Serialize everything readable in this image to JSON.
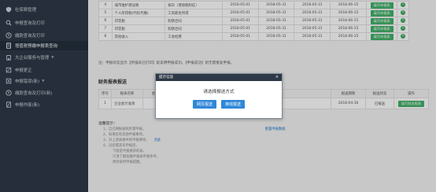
{
  "sidebar": {
    "items": [
      {
        "label": "社保费管理",
        "icon": "shield-icon"
      },
      {
        "label": "申报查询及打印",
        "icon": "search-icon"
      },
      {
        "label": "缴款查询及打印",
        "icon": "payment-icon"
      },
      {
        "label": "增值税预缴申报表查询",
        "icon": "document-icon"
      },
      {
        "label": "大企业服务与管理",
        "icon": "building-icon"
      },
      {
        "label": "申报更正",
        "icon": "edit-icon"
      },
      {
        "label": "申报错误(新)",
        "icon": "error-icon"
      },
      {
        "label": "缴款查询及打印(新)",
        "icon": "payment-icon"
      },
      {
        "label": "申报作废(新)",
        "icon": "void-icon"
      }
    ]
  },
  "tax_table": {
    "rows": [
      {
        "no": "4",
        "name": "城市维护建设税",
        "period_type": "按日（增值税附征）",
        "start": "2018-05-01",
        "end": "2018-05-31",
        "end2": "2018-05-31",
        "deadline": "2018-06-15",
        "action": "填写申报表"
      },
      {
        "no": "5",
        "name": "个人所得税(代扣代缴)",
        "period_type": "工资薪金所得",
        "start": "2018-05-01",
        "end": "2018-05-31",
        "end2": "2018-05-31",
        "deadline": "2018-06-15",
        "action": "填写申报表"
      },
      {
        "no": "6",
        "name": "印花税",
        "period_type": "购销合同",
        "start": "2018-05-01",
        "end": "2018-05-31",
        "end2": "2018-05-31",
        "deadline": "2018-06-15",
        "action": "填写申报表"
      },
      {
        "no": "7",
        "name": "印花税",
        "period_type": "购销合同",
        "start": "2018-05-01",
        "end": "2018-05-31",
        "end2": "2018-05-31",
        "deadline": "2018-06-15",
        "action": "填写申报表"
      },
      {
        "no": "8",
        "name": "其他收入",
        "period_type": "工会经费",
        "start": "2018-05-01",
        "end": "2018-05-31",
        "end2": "2018-05-31",
        "deadline": "2018-06-15",
        "action": "填写申报表"
      }
    ]
  },
  "note": "注：申报状态显示【所报表已打印】就说明申报成功，【申报成功】则无需重复申报。",
  "financial": {
    "title": "财务报表报送",
    "headers": [
      "序号",
      "报表名称",
      "会计制度",
      "",
      "",
      "报送期限",
      "报送状态",
      "操作"
    ],
    "row": {
      "no": "1",
      "name": "企业会计准则",
      "deadline": "2018-04-16",
      "status": "已报送",
      "action": "填写财务报表"
    }
  },
  "tips": {
    "title": "温馨提示：",
    "lines": [
      "1、自已网报按照步骤申报，",
      "2、如果您有其他申报事项，",
      "3、对上述表格中的申报事项，",
      "4、没有需求有申报后，",
      "下面是申报要求的表，",
      "只须了解准确申报表申报条件，",
      "更改按时申报提醒，"
    ],
    "link1": "重置申报数据",
    "link2": "点此"
  },
  "dialog": {
    "title": "提示信息",
    "close": "×",
    "message": "请选择报送方式",
    "btn_online": "网页报送",
    "btn_offline": "离线报送"
  },
  "colors": {
    "sidebar_bg": "#2e3947",
    "accent_blue": "#2f88d8",
    "accent_green": "#42b16a"
  }
}
